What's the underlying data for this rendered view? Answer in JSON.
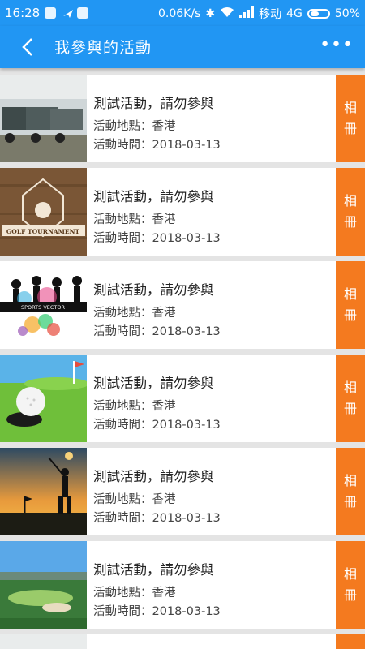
{
  "status_bar": {
    "time": "16:28",
    "speed": "0.06K/s",
    "carrier": "移动",
    "network": "4G",
    "battery": "50%"
  },
  "header": {
    "title": "我參與的活動",
    "back_icon": "back-arrow-icon",
    "more_icon": "more-dots-icon"
  },
  "events": [
    {
      "title": "測試活動，請勿參與",
      "place": "活動地點：香港",
      "time": "活動時間：2018-03-13",
      "album_label": "相冊",
      "thumb": "golf-carts"
    },
    {
      "title": "測試活動，請勿參與",
      "place": "活動地點：香港",
      "time": "活動時間：2018-03-13",
      "album_label": "相冊",
      "thumb": "golf-tournament-badge"
    },
    {
      "title": "測試活動，請勿參與",
      "place": "活動地點：香港",
      "time": "活動時間：2018-03-13",
      "album_label": "相冊",
      "thumb": "sports-vector"
    },
    {
      "title": "測試活動，請勿參與",
      "place": "活動地點：香港",
      "time": "活動時間：2018-03-13",
      "album_label": "相冊",
      "thumb": "golf-ball-hole"
    },
    {
      "title": "測試活動，請勿參與",
      "place": "活動地點：香港",
      "time": "活動時間：2018-03-13",
      "album_label": "相冊",
      "thumb": "golfer-sunset"
    },
    {
      "title": "測試活動，請勿參與",
      "place": "活動地點：香港",
      "time": "活動時間：2018-03-13",
      "album_label": "相冊",
      "thumb": "golf-course"
    }
  ],
  "thumb_badge_text": "GOLF TOURNAMENT",
  "thumb_sports_text": "SPORTS VECTOR",
  "colors": {
    "primary": "#2196f3",
    "accent": "#f47a1f"
  }
}
